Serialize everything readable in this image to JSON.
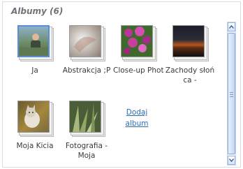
{
  "header": {
    "title": "Albumy (6)"
  },
  "albums": [
    {
      "label": "Ja",
      "thumb": "person-photo"
    },
    {
      "label": "Abstrakcja ;P",
      "thumb": "abstract-photo"
    },
    {
      "label": "Close-up Photograph",
      "thumb": "flowers-photo"
    },
    {
      "label": "Zachody słońca -",
      "thumb": "sunset-photo"
    },
    {
      "label": "Moja Kicia",
      "thumb": "cat-photo"
    },
    {
      "label": "Fotografia - Moja",
      "thumb": "grass-photo"
    }
  ],
  "add_album": {
    "label": "Dodaj album"
  },
  "colors": {
    "accent": "#2a6bb3",
    "selected_border": "#5a8fd6",
    "header_text": "#6f7379"
  },
  "icons": {
    "scroll_up": "chevron-up-icon",
    "scroll_down": "chevron-down-icon"
  }
}
